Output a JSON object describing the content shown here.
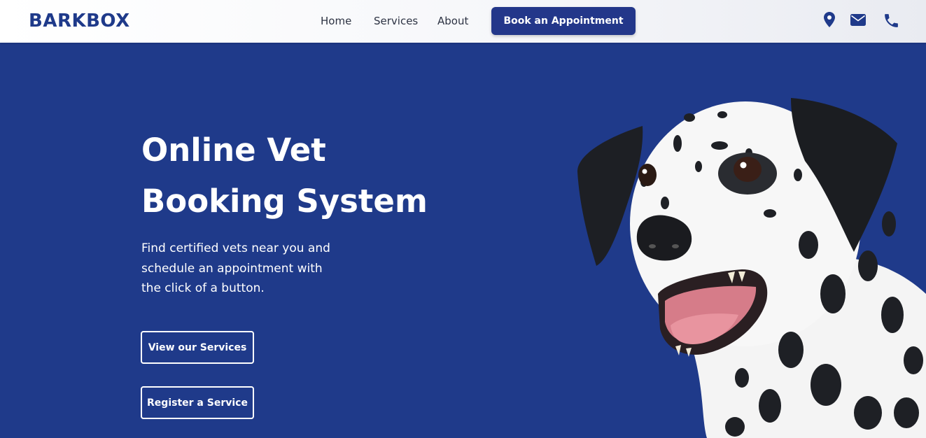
{
  "header": {
    "logo": "BARKBOX",
    "nav": [
      {
        "label": "Home"
      },
      {
        "label": "Services"
      },
      {
        "label": "About"
      }
    ],
    "cta_label": "Book an Appointment",
    "icons": [
      "location-pin-icon",
      "envelope-icon",
      "phone-icon"
    ]
  },
  "hero": {
    "title_line1": "Online Vet",
    "title_line2": "Booking System",
    "description": "Find certified vets near you and schedule an appointment with the click of a button.",
    "primary_button": "View our Services",
    "secondary_button": "Register a Service"
  },
  "colors": {
    "brand_blue": "#1f3a8a",
    "button_blue": "#23378a",
    "text_dark": "#2d3343",
    "white": "#ffffff"
  }
}
